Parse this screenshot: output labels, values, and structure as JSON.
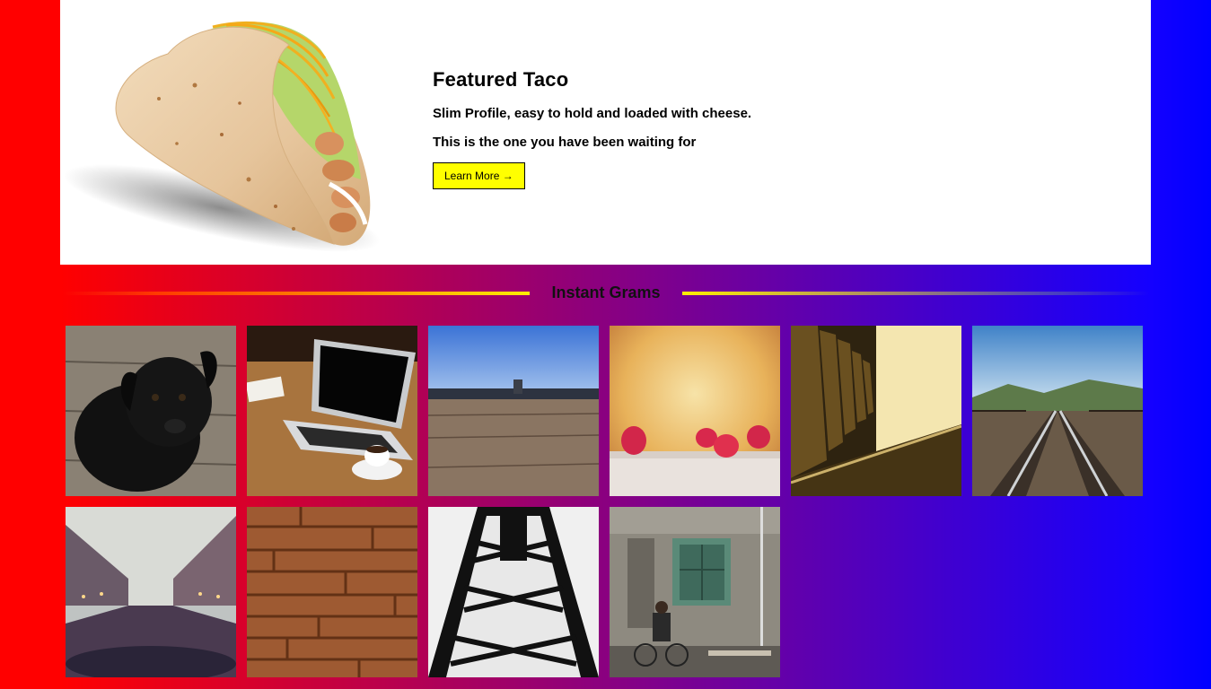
{
  "feature": {
    "title": "Featured Taco",
    "line1": "Slim Profile, easy to hold and loaded with cheese.",
    "line2": "This is the one you have been waiting for",
    "button_label": "Learn More →",
    "button_color": "#ffff00"
  },
  "grams": {
    "title": "Instant Grams",
    "photos": [
      "black-puppy",
      "laptop-coffee",
      "wooden-pier",
      "raspberries",
      "train-seats",
      "railway-tracks",
      "canal-city",
      "wood-planks",
      "steel-tower",
      "old-building-cyclist"
    ]
  },
  "colors": {
    "left": "#ff0000",
    "right": "#0000ff",
    "panel": "#ffffff"
  }
}
